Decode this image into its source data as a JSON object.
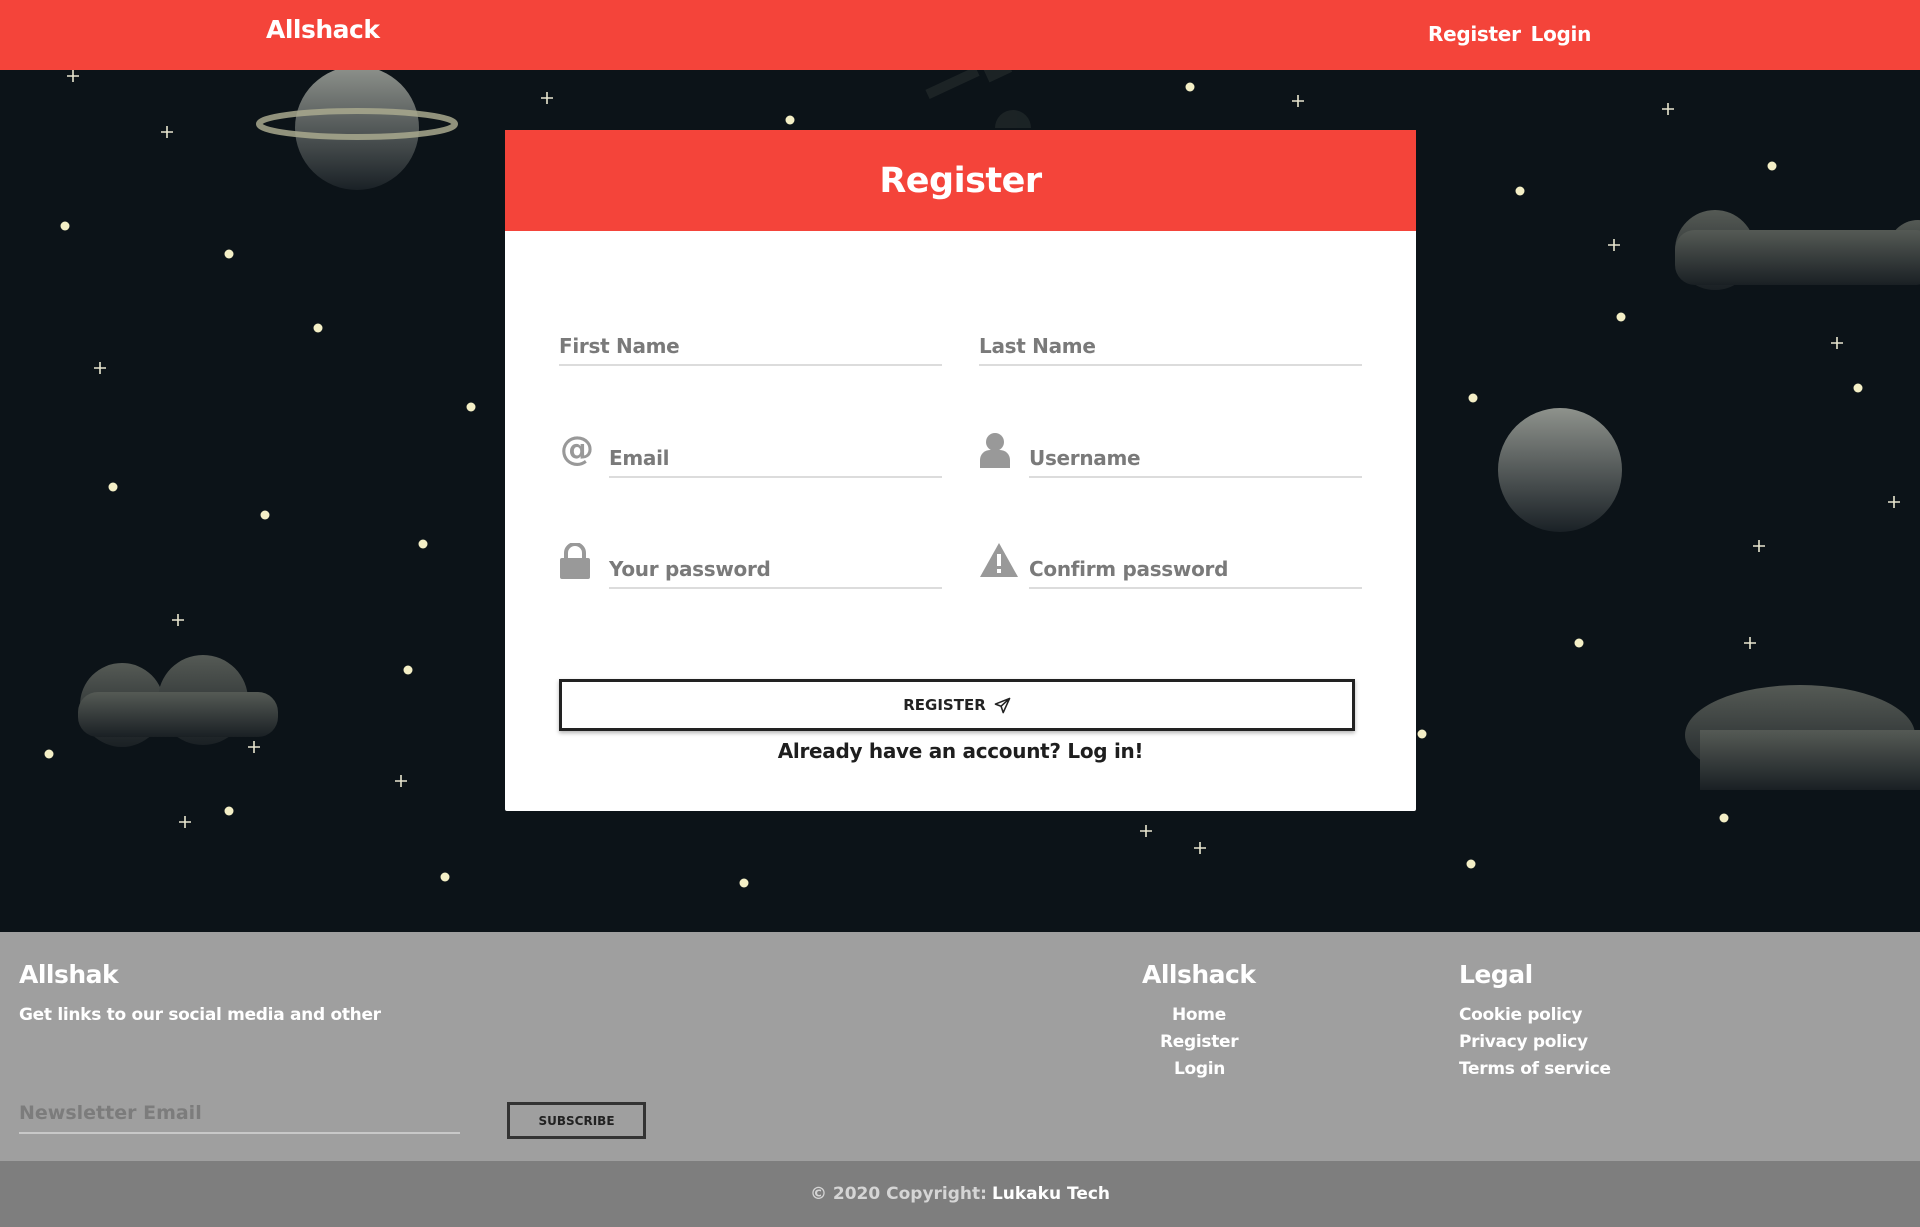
{
  "colors": {
    "accent": "#f4443a",
    "space": "#0c1318",
    "footer": "#9f9f9f",
    "footer_bottom": "#7e7e7e"
  },
  "nav": {
    "brand": "Allshack",
    "register": "Register",
    "login": "Login"
  },
  "card": {
    "title": "Register",
    "first_name": "First Name",
    "last_name": "Last Name",
    "email": "Email",
    "username": "Username",
    "password": "Your password",
    "confirm": "Confirm password",
    "button": "REGISTER",
    "already": "Already have an account?",
    "login_link": "Log in!"
  },
  "icons": [
    "at-icon",
    "user-icon",
    "lock-icon",
    "warning-icon",
    "paper-plane-icon"
  ],
  "footer": {
    "brand_title": "Allshak",
    "brand_text": "Get links to our social media and other",
    "newsletter_placeholder": "Newsletter Email",
    "subscribe": "SUBSCRIBE",
    "nav_title": "Allshack",
    "nav_links": [
      "Home",
      "Register",
      "Login"
    ],
    "legal_title": "Legal",
    "legal_links": [
      "Cookie policy",
      "Privacy policy",
      "Terms of service"
    ]
  },
  "copyright": {
    "text": "© 2020 Copyright:",
    "owner": "Lukaku Tech"
  }
}
